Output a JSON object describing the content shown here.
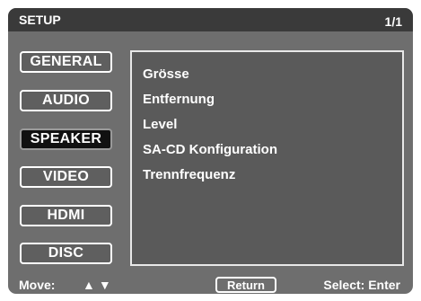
{
  "header": {
    "title": "SETUP",
    "page": "1/1"
  },
  "tabs": [
    {
      "label": "GENERAL",
      "active": false
    },
    {
      "label": "AUDIO",
      "active": false
    },
    {
      "label": "SPEAKER",
      "active": true
    },
    {
      "label": "VIDEO",
      "active": false
    },
    {
      "label": "HDMI",
      "active": false
    },
    {
      "label": "DISC",
      "active": false
    }
  ],
  "menu": {
    "items": [
      "Grösse",
      "Entfernung",
      "Level",
      "SA-CD Konfiguration",
      "Trennfrequenz"
    ]
  },
  "footer": {
    "move_label": "Move:",
    "up_arrow": "▲",
    "down_arrow": "▼",
    "return_label": "Return",
    "select_label": "Select: Enter"
  },
  "colors": {
    "background": "#6e6e6e",
    "titlebar": "#3a3a3a",
    "active_tab": "#111111",
    "text": "#ffffff"
  }
}
